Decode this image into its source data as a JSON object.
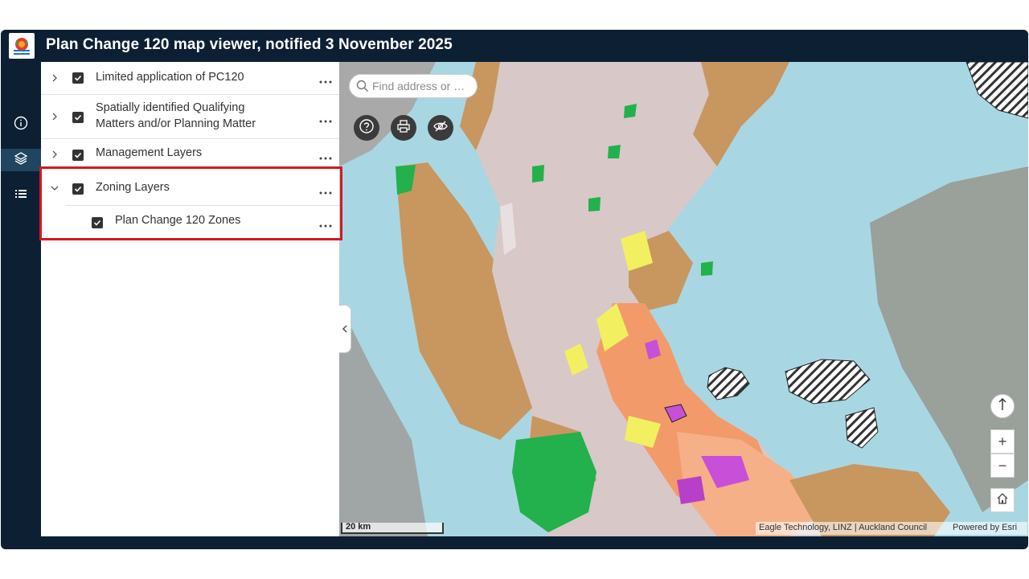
{
  "header": {
    "title": "Plan Change 120 map viewer, notified 3 November 2025"
  },
  "rail": {
    "items": [
      {
        "icon": "info-icon"
      },
      {
        "icon": "layers-icon"
      },
      {
        "icon": "legend-list-icon"
      }
    ]
  },
  "layers": {
    "items": [
      {
        "label": "Limited application of PC120"
      },
      {
        "label_line1": "Spatially identified Qualifying",
        "label_line2": "Matters and/or Planning Matter"
      },
      {
        "label": "Management Layers"
      },
      {
        "label": "Zoning Layers"
      },
      {
        "label": "Plan Change 120 Zones"
      }
    ]
  },
  "map": {
    "search_placeholder": "Find address or …",
    "scale": "20 km",
    "attribution": "Eagle Technology, LINZ | Auckland Council",
    "powered_by": "Powered by Esri",
    "zoom_in": "+",
    "zoom_out": "−"
  },
  "colors": {
    "header_bg": "#0d1f33",
    "highlight": "#d9171f",
    "water": "#a8d7e3",
    "residential": "#d8c8c8",
    "rural": "#c8965f",
    "open_space": "#22b14c",
    "business": "#f2f060",
    "mixed": "#f39a6b"
  }
}
